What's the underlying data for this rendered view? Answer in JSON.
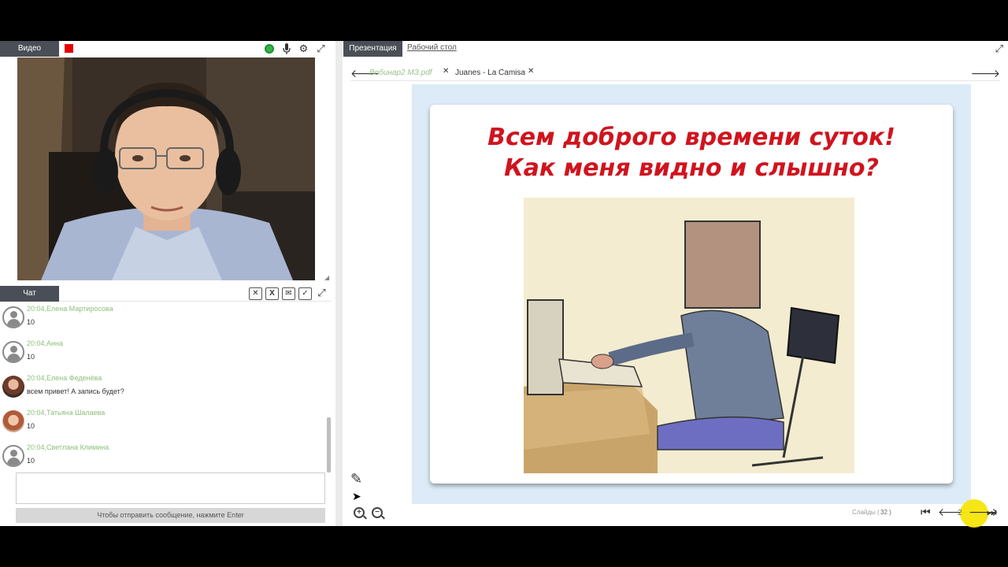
{
  "video_panel": {
    "tab_label": "Видео",
    "record_color": "#e30000",
    "icons": [
      "camera-status-icon",
      "microphone-icon",
      "gear-icon",
      "expand-icon"
    ]
  },
  "chat_panel": {
    "tab_label": "Чат",
    "icons": [
      "clear-chat-icon",
      "excel-export-icon",
      "mail-icon",
      "check-icon",
      "expand-icon"
    ],
    "messages": [
      {
        "header": "20:04,Елена Мартиросова",
        "text": "10",
        "avatar": "default"
      },
      {
        "header": "20:04,Анна",
        "text": "10",
        "avatar": "default"
      },
      {
        "header": "20:04,Елена Феденёва",
        "text": "всем привет! А запись будет?",
        "avatar": "photo"
      },
      {
        "header": "20:04,Татьяна Шалаева",
        "text": "10",
        "avatar": "photo2"
      },
      {
        "header": "20:04,Светлана Климина",
        "text": "10",
        "avatar": "default"
      }
    ],
    "input_placeholder": "",
    "send_hint": "Чтобы отправить сообщение, нажмите Enter"
  },
  "presentation": {
    "tab_label": "Презентация",
    "desktop_tab_label": "Рабочий стол",
    "documents": [
      {
        "name": "Вебинар2 МЗ.pdf",
        "active": false
      },
      {
        "name": "Juanes - La Camisa",
        "active": true
      }
    ],
    "slide": {
      "title_line1": "Всем доброго времени суток!",
      "title_line2": "Как меня видно и слышно?"
    },
    "footer": {
      "slides_label": "Слайды (",
      "slides_total": "32  )",
      "current_page": "2"
    }
  },
  "colors": {
    "tab_bg": "#4a4f57",
    "slide_bg": "#dcebf7",
    "title_red": "#d0141e",
    "chat_name_green": "#8cbf7a"
  }
}
